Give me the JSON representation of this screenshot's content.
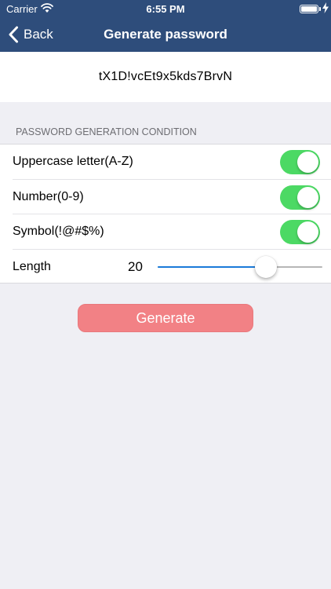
{
  "status_bar": {
    "carrier": "Carrier",
    "time": "6:55 PM"
  },
  "nav": {
    "back_label": "Back",
    "title": "Generate password"
  },
  "password": "tX1D!vcEt9x5kds7BrvN",
  "section_header": "PASSWORD GENERATION CONDITION",
  "conditions": [
    {
      "label": "Uppercase letter(A-Z)",
      "enabled": true
    },
    {
      "label": "Number(0-9)",
      "enabled": true
    },
    {
      "label": "Symbol(!@#$%)",
      "enabled": true
    }
  ],
  "length": {
    "label": "Length",
    "value": "20",
    "slider_fraction": 0.655
  },
  "generate_label": "Generate",
  "colors": {
    "nav_background": "#2e4d7b",
    "toggle_on": "#4cd964",
    "slider_fill": "#1a7ad9",
    "generate_button": "#f28185",
    "page_background": "#efeff4"
  },
  "icons": [
    "wifi-icon",
    "battery-icon",
    "charging-bolt-icon",
    "chevron-left-icon"
  ]
}
